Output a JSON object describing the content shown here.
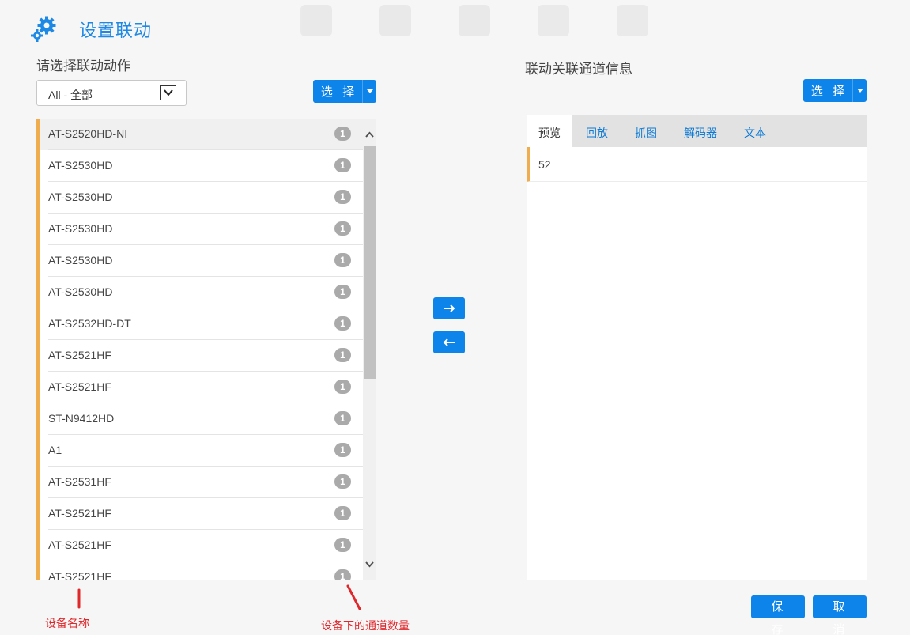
{
  "dialog": {
    "title": "设置联动"
  },
  "left_panel": {
    "title": "请选择联动动作",
    "filter": {
      "selected": "All - 全部"
    },
    "select_button": "选 择",
    "devices": [
      {
        "name": "AT-S2520HD-NI",
        "count": "1"
      },
      {
        "name": "AT-S2530HD",
        "count": "1"
      },
      {
        "name": "AT-S2530HD",
        "count": "1"
      },
      {
        "name": "AT-S2530HD",
        "count": "1"
      },
      {
        "name": "AT-S2530HD",
        "count": "1"
      },
      {
        "name": "AT-S2530HD",
        "count": "1"
      },
      {
        "name": "AT-S2532HD-DT",
        "count": "1"
      },
      {
        "name": "AT-S2521HF",
        "count": "1"
      },
      {
        "name": "AT-S2521HF",
        "count": "1"
      },
      {
        "name": "ST-N9412HD",
        "count": "1"
      },
      {
        "name": "A1",
        "count": "1"
      },
      {
        "name": "AT-S2531HF",
        "count": "1"
      },
      {
        "name": "AT-S2521HF",
        "count": "1"
      },
      {
        "name": "AT-S2521HF",
        "count": "1"
      },
      {
        "name": "AT-S2521HF",
        "count": "1"
      }
    ]
  },
  "transfer": {
    "right_icon": "arrow-right-icon",
    "left_icon": "arrow-left-icon"
  },
  "right_panel": {
    "title": "联动关联通道信息",
    "select_button": "选 择",
    "tabs": [
      {
        "label": "预览",
        "active": true
      },
      {
        "label": "回放",
        "active": false
      },
      {
        "label": "抓图",
        "active": false
      },
      {
        "label": "解码器",
        "active": false
      },
      {
        "label": "文本",
        "active": false
      }
    ],
    "channels": [
      {
        "value": "52"
      }
    ]
  },
  "footer": {
    "save": "保 存",
    "cancel": "取 消"
  },
  "annotations": {
    "device_name": "设备名称",
    "channel_count": "设备下的通道数量"
  },
  "colors": {
    "accent": "#0d84ea",
    "row_marker": "#f0ad4e",
    "annotation": "#e0272b"
  }
}
